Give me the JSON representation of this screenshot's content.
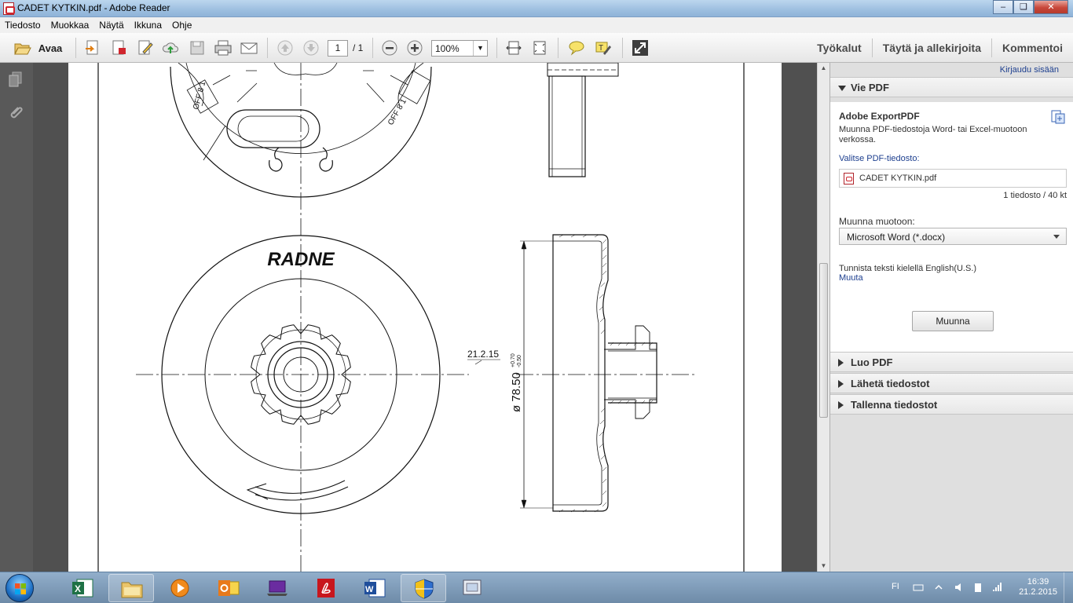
{
  "window": {
    "title": "CADET KYTKIN.pdf - Adobe Reader"
  },
  "menu": [
    "Tiedosto",
    "Muokkaa",
    "Näytä",
    "Ikkuna",
    "Ohje"
  ],
  "toolbar": {
    "open_label": "Avaa",
    "page_current": "1",
    "page_total": "/ 1",
    "zoom": "100%",
    "tabs": [
      "Työkalut",
      "Täytä ja allekirjoita",
      "Kommentoi"
    ]
  },
  "drawing": {
    "logo_text": "RADNE",
    "dimension_main": "ø 78.50",
    "tolerance_upper": "+0.70",
    "tolerance_lower": "-0.50",
    "revision_note": "21.2.15",
    "offset_label_left": "OFF 8 1",
    "offset_label_right": "OFF 8 1"
  },
  "right_pane": {
    "sign_in": "Kirjaudu sisään",
    "export": {
      "section_title": "Vie PDF",
      "product": "Adobe ExportPDF",
      "description": "Muunna PDF-tiedostoja Word- tai Excel-muotoon verkossa.",
      "select_label": "Valitse PDF-tiedosto:",
      "file_name": "CADET KYTKIN.pdf",
      "file_count": "1 tiedosto / 40 kt",
      "convert_to_label": "Muunna muotoon:",
      "format": "Microsoft Word (*.docx)",
      "ocr_text": "Tunnista teksti kielellä English(U.S.)",
      "change_link": "Muuta",
      "convert_button": "Muunna"
    },
    "sections": [
      "Luo PDF",
      "Lähetä tiedostot",
      "Tallenna tiedostot"
    ]
  },
  "taskbar": {
    "apps": [
      "Excel",
      "Windows Explorer",
      "Media Player",
      "Outlook",
      "Laptop",
      "Adobe Reader",
      "Word",
      "Security Center",
      "Remote Desktop"
    ],
    "language": "FI",
    "time": "16:39",
    "date": "21.2.2015"
  },
  "colors": {
    "accent": "#1d3f8f",
    "pane_bg": "#dfdfdf",
    "doc_bg": "#505050"
  }
}
